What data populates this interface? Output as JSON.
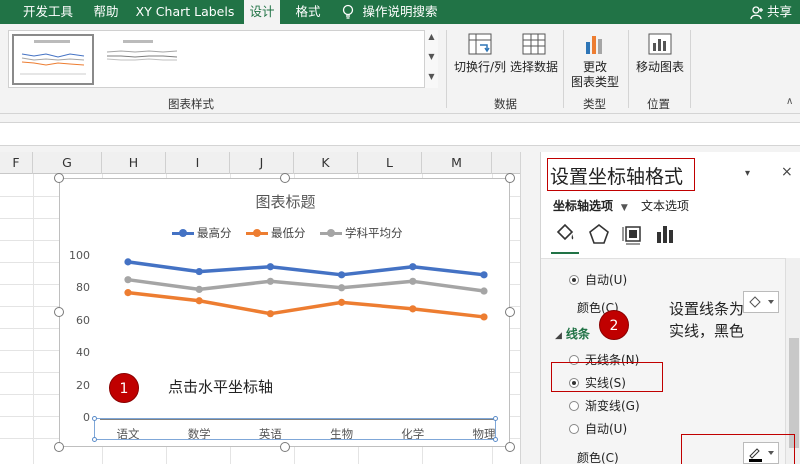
{
  "ribbon": {
    "tabs": [
      {
        "label": "开发工具",
        "active": false
      },
      {
        "label": "帮助",
        "active": false
      },
      {
        "label": "XY Chart Labels",
        "active": false
      },
      {
        "label": "设计",
        "active": true
      },
      {
        "label": "格式",
        "active": false
      }
    ],
    "tell_me": "操作说明搜索",
    "share": "共享",
    "gallery_group_label": "图表样式",
    "buttons": {
      "switch_row_col": "切换行/列",
      "select_data": "选择数据",
      "change_type_line1": "更改",
      "change_type_line2": "图表类型",
      "move_chart": "移动图表"
    },
    "groups": {
      "data": "数据",
      "type": "类型",
      "location": "位置"
    }
  },
  "grid": {
    "columns": [
      "F",
      "G",
      "H",
      "I",
      "J",
      "K",
      "L",
      "M"
    ]
  },
  "chart": {
    "title": "图表标题",
    "legend": [
      "最高分",
      "最低分",
      "学科平均分"
    ]
  },
  "chart_data": {
    "type": "line",
    "title": "图表标题",
    "categories": [
      "语文",
      "数学",
      "英语",
      "生物",
      "化学",
      "物理"
    ],
    "series": [
      {
        "name": "最高分",
        "color": "#4472c4",
        "values": [
          97,
          91,
          94,
          89,
          94,
          89
        ]
      },
      {
        "name": "最低分",
        "color": "#ed7d31",
        "values": [
          78,
          73,
          65,
          72,
          68,
          63
        ]
      },
      {
        "name": "学科平均分",
        "color": "#a5a5a5",
        "values": [
          86,
          80,
          85,
          81,
          85,
          79
        ]
      }
    ],
    "yticks": [
      0,
      20,
      40,
      60,
      80,
      100
    ],
    "ylim": [
      0,
      100
    ],
    "grid": false,
    "legend_position": "top"
  },
  "annotations": {
    "step1_number": "1",
    "step1_text": "点击水平坐标轴",
    "step2_number": "2",
    "step2_text_line1": "设置线条为",
    "step2_text_line2": "实线，黑色"
  },
  "pane": {
    "title": "设置坐标轴格式",
    "tab_axis_options": "坐标轴选项",
    "tab_text_options": "文本选项",
    "close": "×",
    "dropdown": "▾",
    "auto_top": "自动(U)",
    "color_label": "颜色(C)",
    "section_line": "线条",
    "line_options": [
      {
        "label": "无线条(N)",
        "selected": false
      },
      {
        "label": "实线(S)",
        "selected": true
      },
      {
        "label": "渐变线(G)",
        "selected": false
      },
      {
        "label": "自动(U)",
        "selected": false
      }
    ],
    "color_label2": "颜色(C)"
  }
}
